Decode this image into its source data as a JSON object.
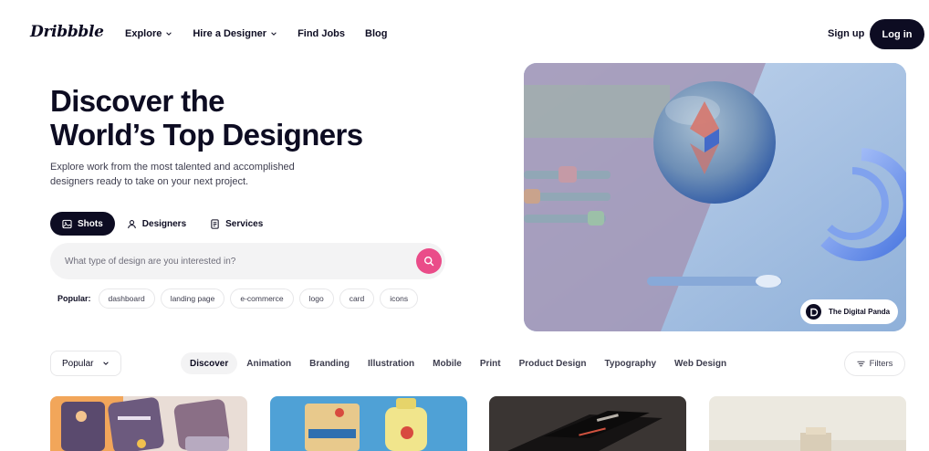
{
  "nav": {
    "logo": "Dribbble",
    "links": [
      {
        "label": "Explore",
        "dropdown": true
      },
      {
        "label": "Hire a Designer",
        "dropdown": true
      },
      {
        "label": "Find Jobs",
        "dropdown": false
      },
      {
        "label": "Blog",
        "dropdown": false
      }
    ],
    "signup": "Sign up",
    "login": "Log in"
  },
  "hero": {
    "title_line1": "Discover the",
    "title_line2": "World’s Top Designers",
    "subtitle": "Explore work from the most talented and accomplished designers ready to take on your next project.",
    "tabs": [
      {
        "label": "Shots",
        "icon": "image-icon",
        "active": true
      },
      {
        "label": "Designers",
        "icon": "person-icon",
        "active": false
      },
      {
        "label": "Services",
        "icon": "document-icon",
        "active": false
      }
    ],
    "search": {
      "placeholder": "What type of design are you interested in?"
    },
    "popular": {
      "label": "Popular:",
      "tags": [
        "dashboard",
        "landing page",
        "e-commerce",
        "logo",
        "card",
        "icons"
      ]
    },
    "art_credit": "The Digital Panda"
  },
  "filter_bar": {
    "sort": "Popular",
    "categories": [
      "Discover",
      "Animation",
      "Branding",
      "Illustration",
      "Mobile",
      "Print",
      "Product Design",
      "Typography",
      "Web Design"
    ],
    "active_category": "Discover",
    "filters": "Filters"
  },
  "colors": {
    "accent": "#ea4c89",
    "dark": "#0d0c22",
    "chip_border": "#e7e7e9",
    "search_bg": "#f3f3f4"
  }
}
